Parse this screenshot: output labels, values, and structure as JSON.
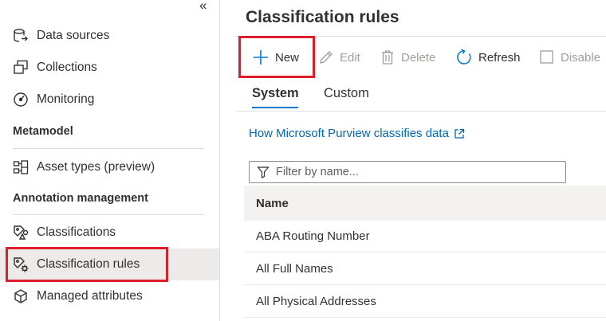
{
  "sidebar": {
    "collapse_glyph": "«",
    "items": {
      "data_sources": {
        "label": "Data sources",
        "icon": "data-sources-icon"
      },
      "collections": {
        "label": "Collections",
        "icon": "collections-icon"
      },
      "monitoring": {
        "label": "Monitoring",
        "icon": "monitoring-icon"
      },
      "asset_types": {
        "label": "Asset types (preview)",
        "icon": "asset-types-icon"
      },
      "classifications": {
        "label": "Classifications",
        "icon": "classifications-icon"
      },
      "classification_rules": {
        "label": "Classification rules",
        "icon": "classification-rules-icon",
        "selected": true
      },
      "managed_attributes": {
        "label": "Managed attributes",
        "icon": "managed-attributes-icon"
      }
    },
    "sections": {
      "metamodel": "Metamodel",
      "annotation": "Annotation management"
    }
  },
  "main": {
    "title": "Classification rules",
    "toolbar": {
      "new": "New",
      "edit": "Edit",
      "delete": "Delete",
      "refresh": "Refresh",
      "disable": "Disable"
    },
    "tabs": {
      "system": "System",
      "custom": "Custom",
      "active": "System"
    },
    "help_link": "How Microsoft Purview classifies data",
    "filter_placeholder": "Filter by name...",
    "table": {
      "header": "Name",
      "rows": [
        "ABA Routing Number",
        "All Full Names",
        "All Physical Addresses"
      ]
    }
  },
  "colors": {
    "accent": "#0078d4",
    "link": "#0067b8",
    "highlight_box": "#e01e2b",
    "selected_bg": "#edebe9"
  }
}
